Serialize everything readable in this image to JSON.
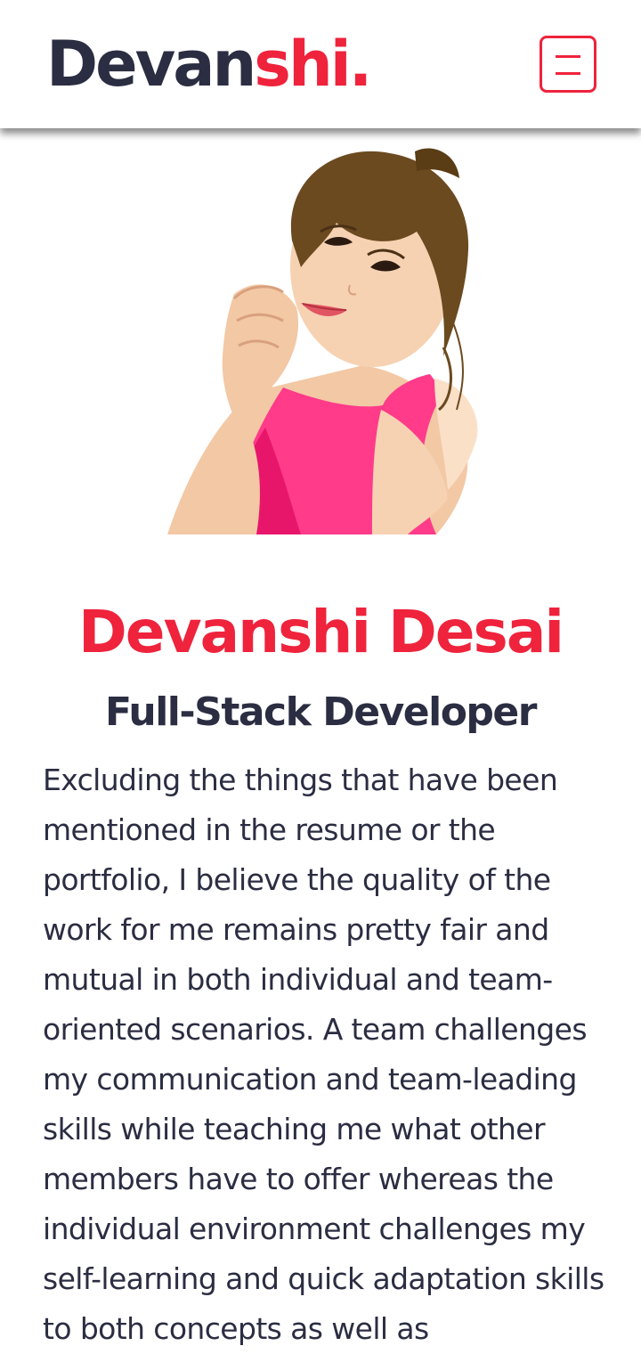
{
  "header": {
    "logo_dark": "Devan",
    "logo_accent": "shi.",
    "menu_icon": "hamburger-menu-icon"
  },
  "hero": {
    "illustration": "avatar-illustration"
  },
  "profile": {
    "name": "Devanshi Desai",
    "role": "Full-Stack Developer",
    "bio": "Excluding the things that have been mentioned in the resume or the portfolio, I believe the quality of the work for me remains pretty fair and mutual in both individual and team-oriented scenarios. A team challenges my communication and team-leading skills while teaching me what other members have to offer whereas the individual environment challenges my self-learning and quick adaptation skills to both concepts as well as"
  },
  "colors": {
    "accent": "#ef233c",
    "dark": "#2b2d42",
    "background": "#ffffff"
  }
}
